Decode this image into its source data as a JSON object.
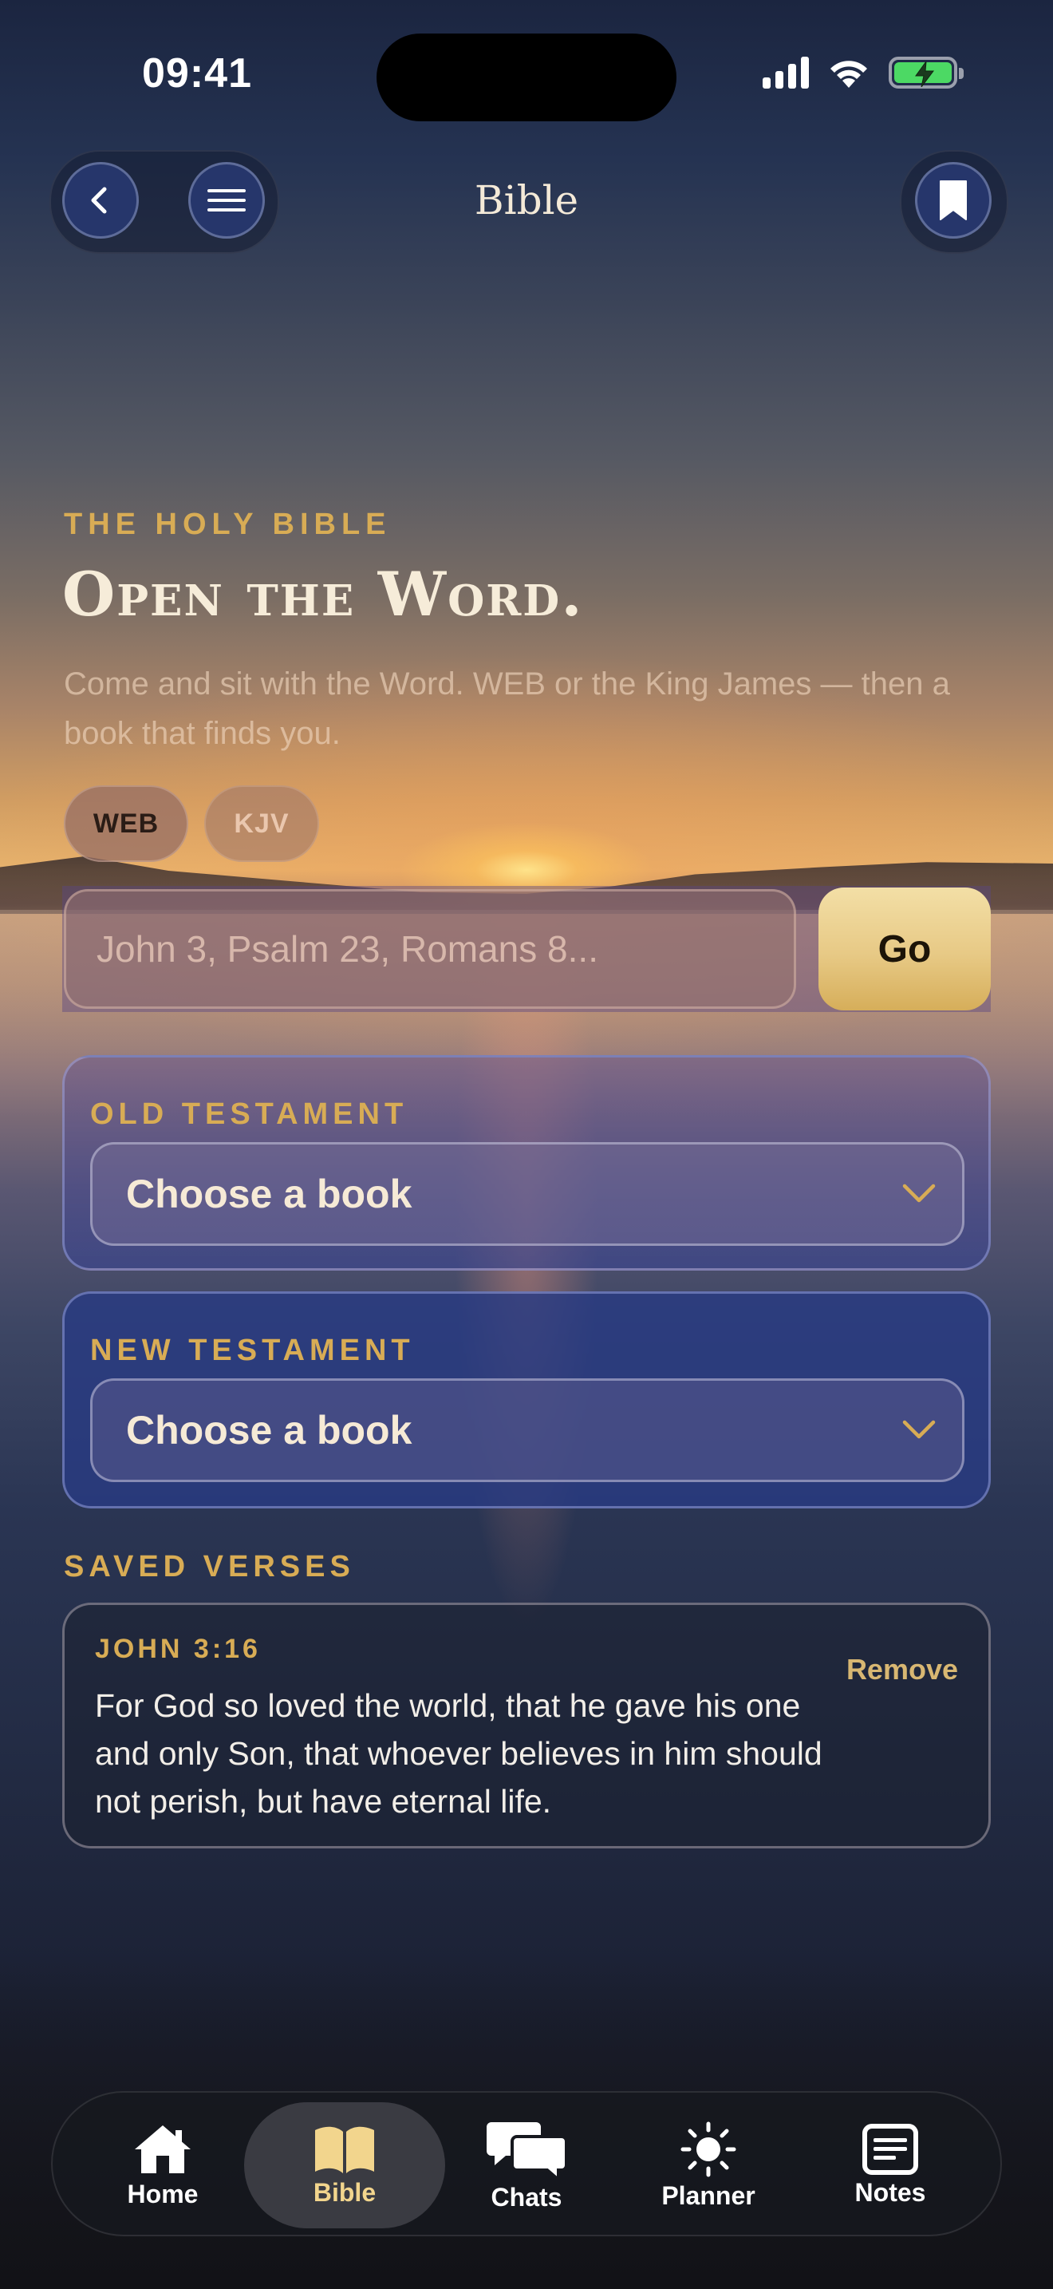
{
  "status_bar": {
    "time": "09:41"
  },
  "nav": {
    "title": "Bible",
    "icons": {
      "back": "chevron-left-icon",
      "menu": "menu-icon",
      "bookmark": "bookmark-icon"
    }
  },
  "hero": {
    "eyebrow": "THE HOLY BIBLE",
    "title": "Open the Word.",
    "subtitle": "Come and sit with the Word. WEB or the King James — then a book that finds you."
  },
  "translations": [
    {
      "label": "WEB",
      "selected": true
    },
    {
      "label": "KJV",
      "selected": false
    }
  ],
  "search": {
    "placeholder": "John 3, Psalm 23, Romans 8...",
    "go_label": "Go"
  },
  "old_testament": {
    "label": "OLD TESTAMENT",
    "select_value": "Choose a book"
  },
  "new_testament": {
    "label": "NEW TESTAMENT",
    "select_value": "Choose a book"
  },
  "saved": {
    "label": "SAVED VERSES",
    "verses": [
      {
        "reference": "JOHN 3:16",
        "text": "For God so loved the world, that he gave his one and only Son, that whoever believes in him should not perish, but have eternal life.",
        "remove_label": "Remove"
      }
    ]
  },
  "tabbar": {
    "active": "Bible",
    "tabs": [
      {
        "label": "Home",
        "icon": "home-icon"
      },
      {
        "label": "Bible",
        "icon": "book-icon"
      },
      {
        "label": "Chats",
        "icon": "chat-bubbles-icon"
      },
      {
        "label": "Planner",
        "icon": "sun-icon"
      },
      {
        "label": "Notes",
        "icon": "notes-icon"
      }
    ]
  },
  "colors": {
    "accent_gold": "#d8ac55",
    "go_button": "#e7c985",
    "card_blue": "#283a82",
    "active_tab_label": "#f2d58d"
  }
}
